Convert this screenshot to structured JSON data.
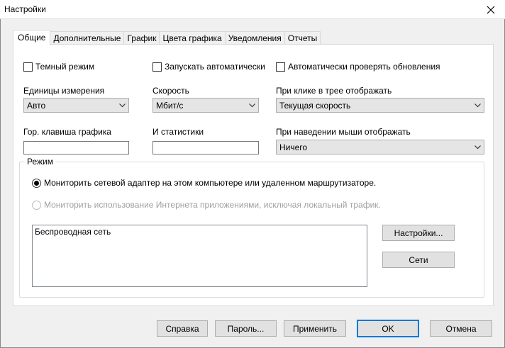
{
  "window": {
    "title": "Настройки"
  },
  "tabs": [
    {
      "label": "Общие"
    },
    {
      "label": "Дополнительные"
    },
    {
      "label": "График"
    },
    {
      "label": "Цвета графика"
    },
    {
      "label": "Уведомления"
    },
    {
      "label": "Отчеты"
    }
  ],
  "general": {
    "dark_mode": {
      "label": "Темный режим",
      "checked": false
    },
    "autostart": {
      "label": "Запускать автоматически",
      "checked": false
    },
    "auto_update": {
      "label": "Автоматически проверять обновления",
      "checked": false
    },
    "units": {
      "label": "Единицы измерения",
      "value": "Авто"
    },
    "speed": {
      "label": "Скорость",
      "value": "Мбит/с"
    },
    "tray_click": {
      "label": "При клике в трее отображать",
      "value": "Текущая скорость"
    },
    "graph_hotkey": {
      "label": "Гор. клавиша графика",
      "value": ""
    },
    "stats_hotkey": {
      "label": "И статистики",
      "value": ""
    },
    "mouse_hover": {
      "label": "При наведении мыши отображать",
      "value": "Ничего"
    }
  },
  "mode": {
    "title": "Режим",
    "option_adapter": {
      "label": "Мониторить сетевой адаптер на этом компьютере или удаленном маршрутизаторе.",
      "selected": true
    },
    "option_apps": {
      "label": "Мониторить использование Интернета приложениями, исключая локальный трафик.",
      "selected": false,
      "disabled": true
    },
    "adapters": [
      "Беспроводная сеть"
    ],
    "settings_button": "Настройки...",
    "networks_button": "Сети"
  },
  "footer": {
    "help": "Справка",
    "password": "Пароль...",
    "apply": "Применить",
    "ok": "OK",
    "cancel": "Отмена"
  }
}
